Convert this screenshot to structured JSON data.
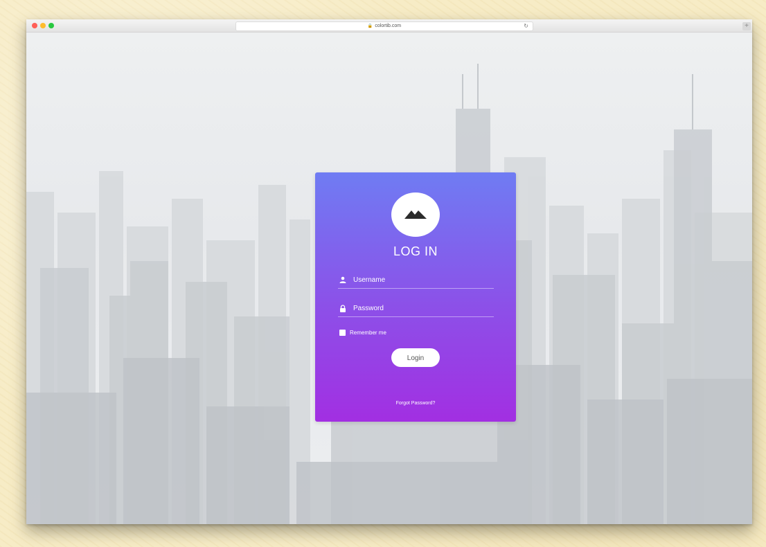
{
  "browser": {
    "url": "colortib.com",
    "new_tab_label": "+",
    "reload_glyph": "↻",
    "lock_glyph": "🔒",
    "traffic_lights": {
      "close": "#ff5f57",
      "minimize": "#febc2e",
      "maximize": "#28c840"
    }
  },
  "login": {
    "title": "LOG IN",
    "username_placeholder": "Username",
    "password_placeholder": "Password",
    "remember_label": "Remember me",
    "login_button": "Login",
    "forgot_link": "Forgot Password?"
  },
  "colors": {
    "card_gradient_top": "#6f7cf3",
    "card_gradient_bottom": "#a22fe2",
    "page_background": "#f7ecc6"
  },
  "icons": {
    "logo": "mountain-icon",
    "username": "user-icon",
    "password": "lock-icon"
  }
}
